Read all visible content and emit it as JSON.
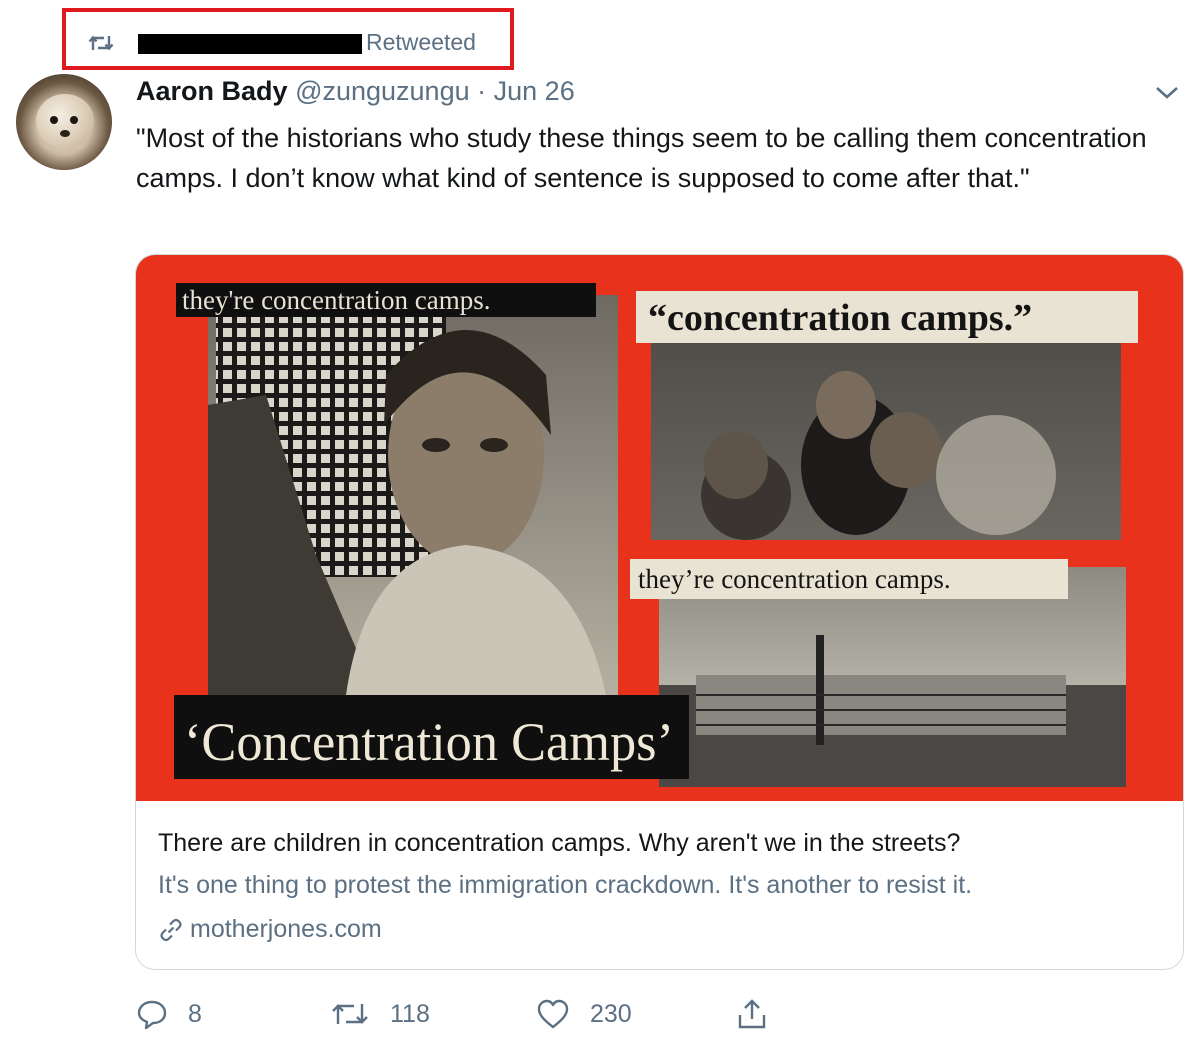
{
  "retweet": {
    "label": "Retweeted",
    "name_redacted": true,
    "highlight_color": "#e0191f"
  },
  "tweet": {
    "author_name": "Aaron Bady",
    "author_handle": "@zunguzungu",
    "separator": "·",
    "date": "Jun 26",
    "text": "\"Most of the historians who study these things seem to be calling them concentration camps. I don’t know what kind of sentence is supposed to come after that.\"",
    "menu_icon": "chevron-down-icon"
  },
  "card": {
    "image": {
      "caption_top_left": "they're concentration camps.",
      "caption_top_right": "“concentration camps.”",
      "caption_middle_right": "they’re concentration camps.",
      "headline": "‘Concentration Camps’",
      "background_color": "#e8321c"
    },
    "title": "There are children in concentration camps. Why aren't we in the streets?",
    "description": "It's one thing to protest the immigration crackdown. It's another to resist it.",
    "domain": "motherjones.com",
    "link_icon": "link-icon"
  },
  "actions": {
    "replies": "8",
    "retweets": "118",
    "likes": "230",
    "icons": [
      "reply-icon",
      "retweet-icon",
      "heart-icon",
      "share-icon"
    ]
  }
}
